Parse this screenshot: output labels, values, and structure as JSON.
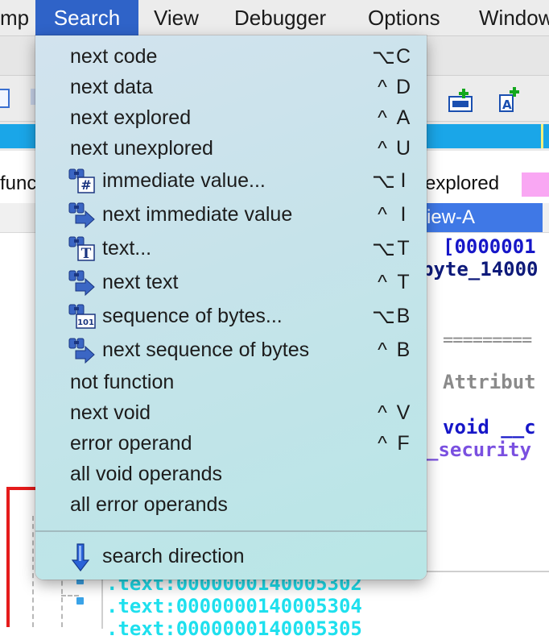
{
  "menubar": {
    "items": [
      {
        "label": "mp"
      },
      {
        "label": "Search"
      },
      {
        "label": "View"
      },
      {
        "label": "Debugger"
      },
      {
        "label": "Options"
      },
      {
        "label": "Window"
      }
    ]
  },
  "background": {
    "legend_left": "func",
    "legend_right": "explored",
    "tab_label": "iew-A",
    "code": {
      "line1": "[0000001",
      "line2": "byte_14000",
      "attrib": "Attribut",
      "void_line": "void __c",
      "security_line": "_security",
      "text_lines": [
        ".text:0000000140005302",
        ".text:0000000140005304",
        ".text:0000000140005305"
      ]
    }
  },
  "search_menu": {
    "items": [
      {
        "label": "next code",
        "mod": "⌥",
        "key": "C",
        "icon": ""
      },
      {
        "label": "next data",
        "mod": "^",
        "key": "D",
        "icon": ""
      },
      {
        "label": "next explored",
        "mod": "^",
        "key": "A",
        "icon": ""
      },
      {
        "label": "next unexplored",
        "mod": "^",
        "key": "U",
        "icon": ""
      },
      {
        "label": "immediate value...",
        "mod": "⌥",
        "key": "I",
        "icon": "binoculars-hash-icon"
      },
      {
        "label": "next immediate value",
        "mod": "^",
        "key": "I",
        "icon": "binoculars-next-icon"
      },
      {
        "label": "text...",
        "mod": "⌥",
        "key": "T",
        "icon": "binoculars-text-icon"
      },
      {
        "label": "next text",
        "mod": "^",
        "key": "T",
        "icon": "binoculars-next-icon"
      },
      {
        "label": "sequence of bytes...",
        "mod": "⌥",
        "key": "B",
        "icon": "binoculars-bytes-icon"
      },
      {
        "label": "next sequence of bytes",
        "mod": "^",
        "key": "B",
        "icon": "binoculars-next-icon"
      },
      {
        "label": "not function",
        "mod": "",
        "key": "",
        "icon": ""
      },
      {
        "label": "next void",
        "mod": "^",
        "key": "V",
        "icon": ""
      },
      {
        "label": "error operand",
        "mod": "^",
        "key": "F",
        "icon": ""
      },
      {
        "label": "all void operands",
        "mod": "",
        "key": "",
        "icon": ""
      },
      {
        "label": "all error operands",
        "mod": "",
        "key": "",
        "icon": ""
      }
    ],
    "direction_item": {
      "label": "search direction",
      "icon": "down-arrow-icon"
    },
    "icon_glyphs": {
      "hash": "#",
      "text": "T",
      "bytes": "101"
    }
  },
  "colors": {
    "menu_highlight": "#2f63c8",
    "nav_strip": "#1aa6e8",
    "tab_active": "#3f78e6",
    "code_blue": "#1616c8",
    "code_cyan": "#1ee0ee"
  }
}
